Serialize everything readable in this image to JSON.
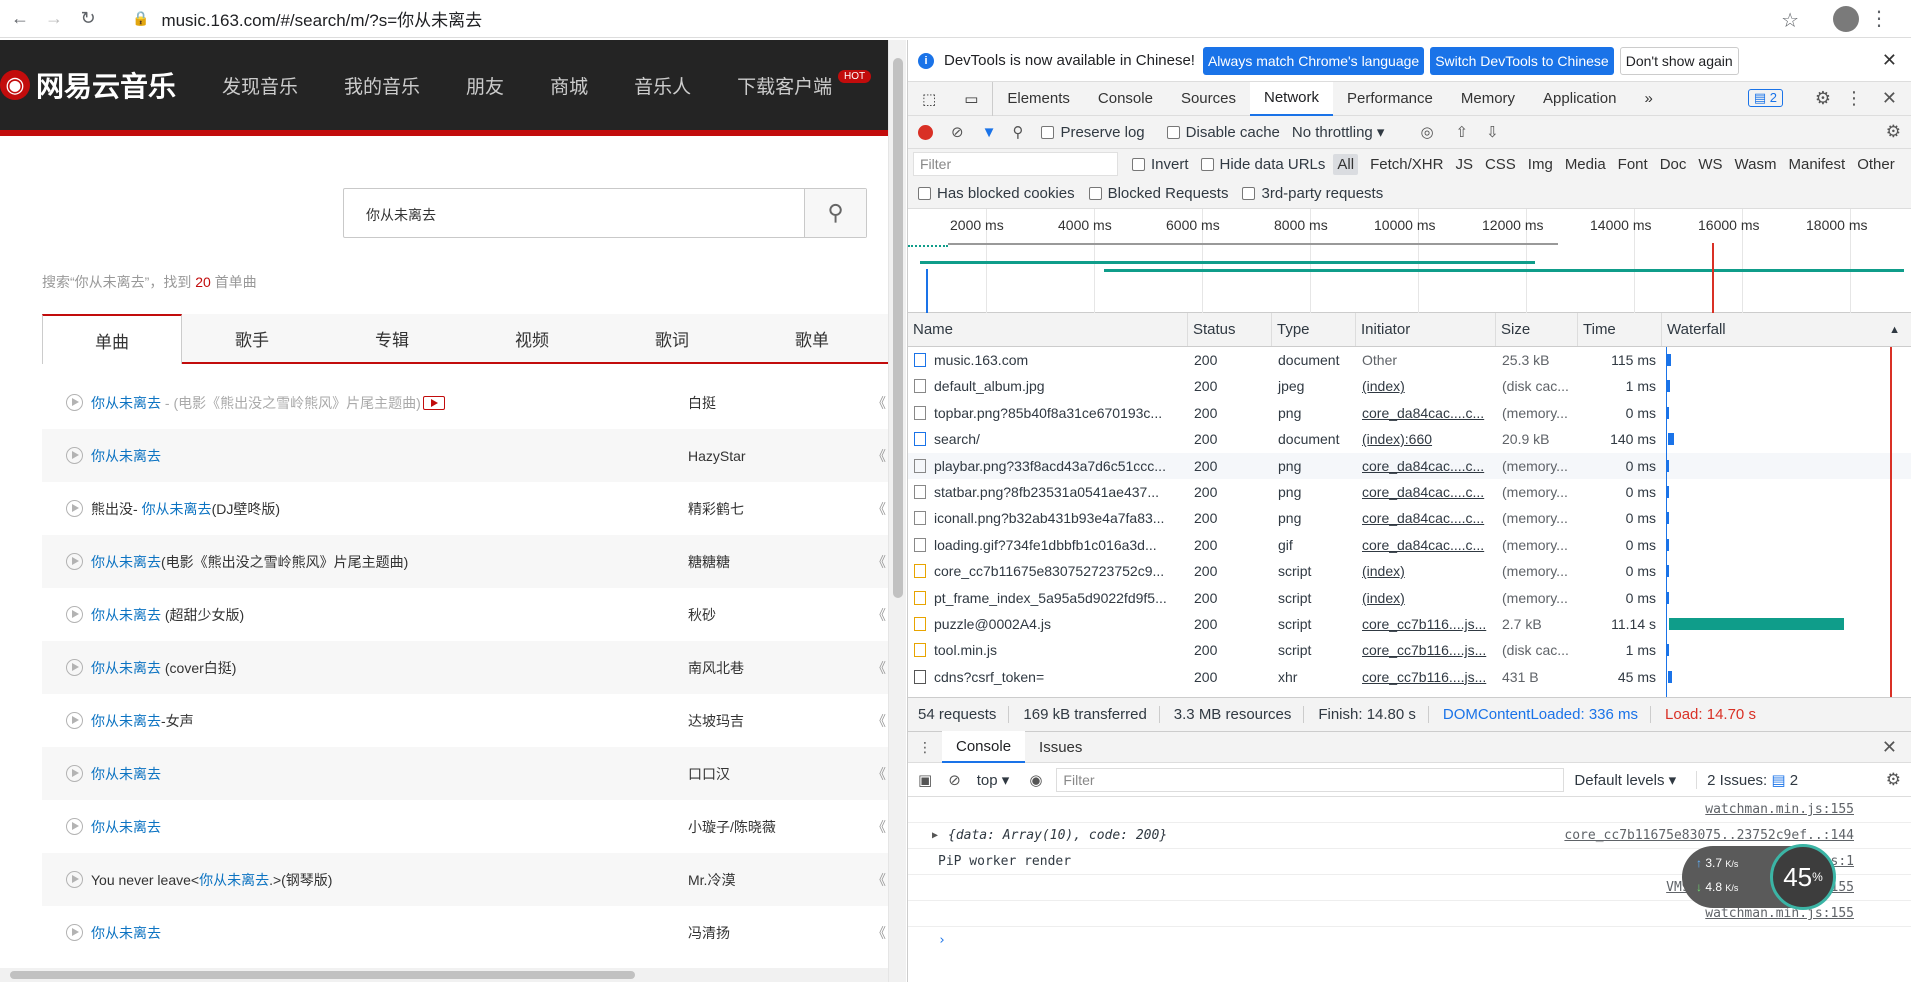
{
  "browser": {
    "url": "music.163.com/#/search/m/?s=你从未离去"
  },
  "site": {
    "logo": "网易云音乐",
    "nav": [
      "发现音乐",
      "我的音乐",
      "朋友",
      "商城",
      "音乐人",
      "下载客户端"
    ],
    "hot_badge": "HOT",
    "search_value": "你从未离去",
    "summary_prefix": "搜索“你从未离去”，找到 ",
    "summary_count": "20",
    "summary_suffix": " 首单曲",
    "tabs": [
      "单曲",
      "歌手",
      "专辑",
      "视频",
      "歌词",
      "歌单"
    ],
    "songs": [
      {
        "pre": "",
        "hl": "你从未离去",
        "post": " - (电影《熊出没之雪岭熊风》片尾主题曲)",
        "artist": "白挺",
        "album": "《"
      },
      {
        "pre": "",
        "hl": "你从未离去",
        "post": "",
        "artist": "HazyStar",
        "album": "《"
      },
      {
        "pre": "熊出没- ",
        "hl": "你从未离去",
        "post": "(DJ壁咚版)",
        "artist": "精彩鹤七",
        "album": "《"
      },
      {
        "pre": "",
        "hl": "你从未离去",
        "post": "(电影《熊出没之雪岭熊风》片尾主题曲)",
        "artist": "糖糖糖",
        "album": "《"
      },
      {
        "pre": "",
        "hl": "你从未离去",
        "post": " (超甜少女版)",
        "artist": "秋砂",
        "album": "《"
      },
      {
        "pre": "",
        "hl": "你从未离去",
        "post": " (cover白挺)",
        "artist": "南风北巷",
        "album": "《"
      },
      {
        "pre": "",
        "hl": "你从未离去",
        "post": "-女声",
        "artist": "达坡玛吉",
        "album": "《"
      },
      {
        "pre": "",
        "hl": "你从未离去",
        "post": "",
        "artist": "口口汉",
        "album": "《"
      },
      {
        "pre": "",
        "hl": "你从未离去",
        "post": "",
        "artist": "小璇子/陈晓薇",
        "album": "《"
      },
      {
        "pre": "You never leave<",
        "hl": "你从未离去",
        "post": ".>(钢琴版)",
        "artist": "Mr.冷漠",
        "album": "《"
      },
      {
        "pre": "",
        "hl": "你从未离去",
        "post": "",
        "artist": "冯清扬",
        "album": "《"
      }
    ]
  },
  "devtools": {
    "info": "DevTools is now available in Chinese!",
    "btn_match": "Always match Chrome's language",
    "btn_switch": "Switch DevTools to Chinese",
    "btn_dont": "Don't show again",
    "tabs": [
      "Elements",
      "Console",
      "Sources",
      "Network",
      "Performance",
      "Memory",
      "Application"
    ],
    "issues_count": "2",
    "preserve_log": "Preserve log",
    "disable_cache": "Disable cache",
    "throttling": "No throttling",
    "filter_placeholder": "Filter",
    "invert": "Invert",
    "hide_data_urls": "Hide data URLs",
    "filter_types": [
      "All",
      "Fetch/XHR",
      "JS",
      "CSS",
      "Img",
      "Media",
      "Font",
      "Doc",
      "WS",
      "Wasm",
      "Manifest",
      "Other"
    ],
    "blocked_cookies": "Has blocked cookies",
    "blocked_requests": "Blocked Requests",
    "third_party": "3rd-party requests",
    "ticks": [
      "2000 ms",
      "4000 ms",
      "6000 ms",
      "8000 ms",
      "10000 ms",
      "12000 ms",
      "14000 ms",
      "16000 ms",
      "18000 ms"
    ],
    "columns": [
      "Name",
      "Status",
      "Type",
      "Initiator",
      "Size",
      "Time",
      "Waterfall"
    ],
    "requests": [
      {
        "name": "music.163.com",
        "status": "200",
        "type": "document",
        "initiator": "Other",
        "size": "25.3 kB",
        "time": "115 ms",
        "icon": "doc"
      },
      {
        "name": "default_album.jpg",
        "status": "200",
        "type": "jpeg",
        "initiator": "(index)",
        "size": "(disk cac...",
        "time": "1 ms",
        "icon": "img"
      },
      {
        "name": "topbar.png?85b40f8a31ce670193c...",
        "status": "200",
        "type": "png",
        "initiator": "core_da84cac....c...",
        "size": "(memory...",
        "time": "0 ms",
        "icon": "img"
      },
      {
        "name": "search/",
        "status": "200",
        "type": "document",
        "initiator": "(index):660",
        "size": "20.9 kB",
        "time": "140 ms",
        "icon": "doc"
      },
      {
        "name": "playbar.png?33f8acd43a7d6c51ccc...",
        "status": "200",
        "type": "png",
        "initiator": "core_da84cac....c...",
        "size": "(memory...",
        "time": "0 ms",
        "icon": "img"
      },
      {
        "name": "statbar.png?8fb23531a0541ae437...",
        "status": "200",
        "type": "png",
        "initiator": "core_da84cac....c...",
        "size": "(memory...",
        "time": "0 ms",
        "icon": "img"
      },
      {
        "name": "iconall.png?b32ab431b93e4a7fa83...",
        "status": "200",
        "type": "png",
        "initiator": "core_da84cac....c...",
        "size": "(memory...",
        "time": "0 ms",
        "icon": "img"
      },
      {
        "name": "loading.gif?734fe1dbbfb1c016a3d...",
        "status": "200",
        "type": "gif",
        "initiator": "core_da84cac....c...",
        "size": "(memory...",
        "time": "0 ms",
        "icon": "img"
      },
      {
        "name": "core_cc7b11675e830752723752c9...",
        "status": "200",
        "type": "script",
        "initiator": "(index)",
        "size": "(memory...",
        "time": "0 ms",
        "icon": "script"
      },
      {
        "name": "pt_frame_index_5a95a5d9022fd9f5...",
        "status": "200",
        "type": "script",
        "initiator": "(index)",
        "size": "(memory...",
        "time": "0 ms",
        "icon": "script"
      },
      {
        "name": "puzzle@0002A4.js",
        "status": "200",
        "type": "script",
        "initiator": "core_cc7b116....js...",
        "size": "2.7 kB",
        "time": "11.14 s",
        "icon": "script"
      },
      {
        "name": "tool.min.js",
        "status": "200",
        "type": "script",
        "initiator": "core_cc7b116....js...",
        "size": "(disk cac...",
        "time": "1 ms",
        "icon": "script"
      },
      {
        "name": "cdns?csrf_token=",
        "status": "200",
        "type": "xhr",
        "initiator": "core_cc7b116....js...",
        "size": "431 B",
        "time": "45 ms",
        "icon": "xhr"
      }
    ],
    "status": {
      "requests": "54 requests",
      "transferred": "169 kB transferred",
      "resources": "3.3 MB resources",
      "finish": "Finish: 14.80 s",
      "dcl": "DOMContentLoaded: 336 ms",
      "load": "Load: 14.70 s"
    },
    "console_tabs": [
      "Console",
      "Issues"
    ],
    "context": "top",
    "console_filter": "Filter",
    "levels": "Default levels",
    "issues_label": "2 Issues:",
    "issues_badge": "2",
    "logs": [
      {
        "text": "",
        "src": "watchman.min.js:155"
      },
      {
        "text": "{data: Array(10), code: 200}",
        "src": "core_cc7b11675e83075..23752c9ef..:144"
      },
      {
        "text": "PiP worker render",
        "src": "...js:1"
      },
      {
        "text": "",
        "src": "VM97 watchman.min.js:155"
      },
      {
        "text": "",
        "src": "watchman.min.js:155"
      }
    ],
    "speed": {
      "up": "3.7",
      "down": "4.8",
      "unit": "K/s",
      "percent": "45",
      "percent_sign": "%"
    }
  },
  "colors": {
    "accent": "#c20c0c",
    "link": "#0c73c2",
    "devtools_blue": "#1a73e8",
    "waterfall": "#0f9d8a"
  }
}
